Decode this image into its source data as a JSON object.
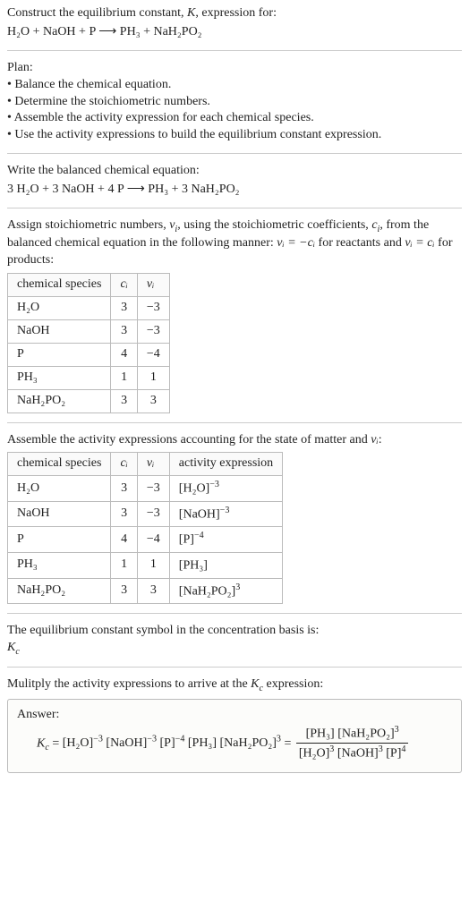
{
  "intro": {
    "line1": "Construct the equilibrium constant, ",
    "Ksym": "K",
    "line1b": ", expression for:",
    "eq_lhs": "H₂O + NaOH + P",
    "arrow": "⟶",
    "eq_rhs": "PH₃ + NaH₂PO₂"
  },
  "plan": {
    "title": "Plan:",
    "items": [
      "Balance the chemical equation.",
      "Determine the stoichiometric numbers.",
      "Assemble the activity expression for each chemical species.",
      "Use the activity expressions to build the equilibrium constant expression."
    ]
  },
  "balanced": {
    "title": "Write the balanced chemical equation:",
    "lhs": "3 H₂O + 3 NaOH + 4 P",
    "arrow": "⟶",
    "rhs": "PH₃ + 3 NaH₂PO₂"
  },
  "assign": {
    "part1": "Assign stoichiometric numbers, ",
    "nu": "ν",
    "sub_i": "i",
    "part2": ", using the stoichiometric coefficients, ",
    "c": "c",
    "part3": ", from the balanced chemical equation in the following manner: ",
    "eq1": "νᵢ = −cᵢ",
    "part4": " for reactants and ",
    "eq2": "νᵢ = cᵢ",
    "part5": " for products:"
  },
  "table1": {
    "headers": [
      "chemical species",
      "cᵢ",
      "νᵢ"
    ],
    "rows": [
      [
        "H₂O",
        "3",
        "−3"
      ],
      [
        "NaOH",
        "3",
        "−3"
      ],
      [
        "P",
        "4",
        "−4"
      ],
      [
        "PH₃",
        "1",
        "1"
      ],
      [
        "NaH₂PO₂",
        "3",
        "3"
      ]
    ]
  },
  "assemble_text": {
    "part1": "Assemble the activity expressions accounting for the state of matter and ",
    "nu": "νᵢ",
    "part2": ":"
  },
  "table2": {
    "headers": [
      "chemical species",
      "cᵢ",
      "νᵢ",
      "activity expression"
    ],
    "rows": [
      {
        "s": "H₂O",
        "c": "3",
        "n": "−3",
        "base": "[H₂O]",
        "exp": "−3"
      },
      {
        "s": "NaOH",
        "c": "3",
        "n": "−3",
        "base": "[NaOH]",
        "exp": "−3"
      },
      {
        "s": "P",
        "c": "4",
        "n": "−4",
        "base": "[P]",
        "exp": "−4"
      },
      {
        "s": "PH₃",
        "c": "1",
        "n": "1",
        "base": "[PH₃]",
        "exp": ""
      },
      {
        "s": "NaH₂PO₂",
        "c": "3",
        "n": "3",
        "base": "[NaH₂PO₂]",
        "exp": "3"
      }
    ]
  },
  "kc_symbol": {
    "line": "The equilibrium constant symbol in the concentration basis is:",
    "sym": "K",
    "sub": "c"
  },
  "multiply": {
    "part1": "Mulitply the activity expressions to arrive at the ",
    "Ksym": "K",
    "Ksub": "c",
    "part2": " expression:"
  },
  "answer": {
    "label": "Answer:",
    "Ksym": "K",
    "Ksub": "c",
    "eq": " = ",
    "flat": {
      "t1": "[H₂O]",
      "e1": "−3",
      "t2": " [NaOH]",
      "e2": "−3",
      "t3": " [P]",
      "e3": "−4",
      "t4": " [PH₃] [NaH₂PO₂]",
      "e4": "3"
    },
    "frac": {
      "num_a": "[PH₃] [NaH₂PO₂]",
      "num_e": "3",
      "den_a": "[H₂O]",
      "den_ae": "3",
      "den_b": " [NaOH]",
      "den_be": "3",
      "den_c": " [P]",
      "den_ce": "4"
    }
  },
  "chart_data": null
}
